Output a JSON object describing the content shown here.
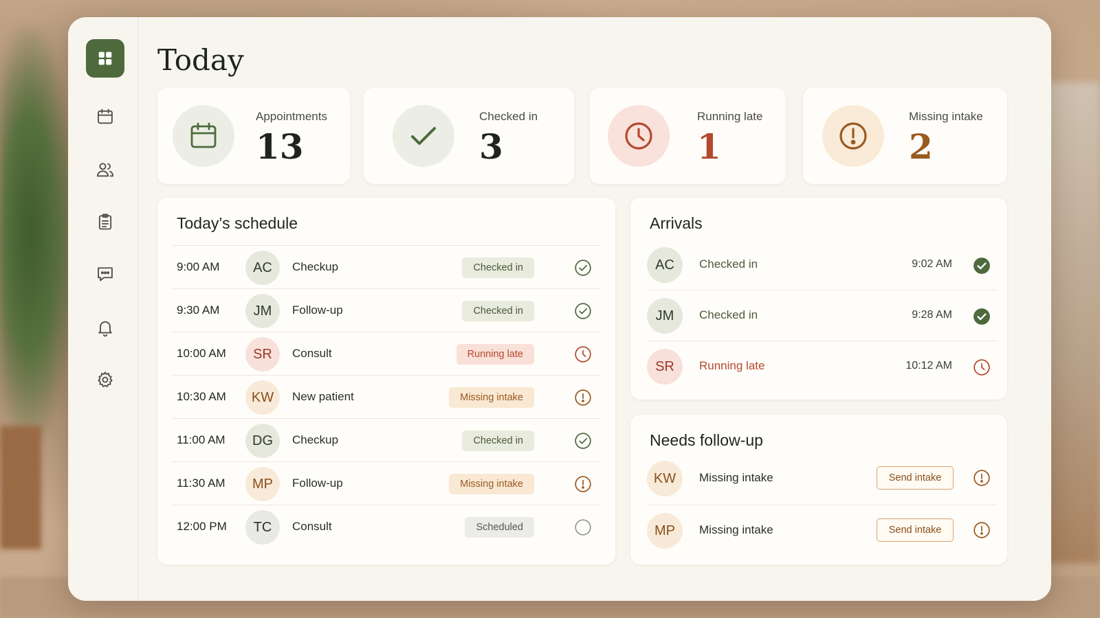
{
  "page": {
    "title": "Today"
  },
  "sidebar": {
    "items": [
      {
        "name": "dashboard",
        "icon": "grid-icon",
        "active": true
      },
      {
        "name": "calendar",
        "icon": "calendar-icon",
        "active": false
      },
      {
        "name": "patients",
        "icon": "users-icon",
        "active": false
      },
      {
        "name": "forms",
        "icon": "clipboard-icon",
        "active": false
      },
      {
        "name": "messages",
        "icon": "chat-icon",
        "active": false
      },
      {
        "name": "notifications",
        "icon": "bell-icon",
        "active": false
      },
      {
        "name": "settings",
        "icon": "gear-icon",
        "active": false
      }
    ]
  },
  "stats": [
    {
      "label": "Appointments",
      "value": "13",
      "icon": "calendar-icon",
      "color": "#1f2420"
    },
    {
      "label": "Checked in",
      "value": "3",
      "icon": "check-icon",
      "color": "#1f2420"
    },
    {
      "label": "Running late",
      "value": "1",
      "icon": "clock-icon",
      "color": "#b3492e"
    },
    {
      "label": "Missing intake",
      "value": "2",
      "icon": "alert-icon",
      "color": "#9a5a21"
    }
  ],
  "schedule": {
    "title": "Today’s schedule",
    "rows": [
      {
        "time": "9:00 AM",
        "initials": "AC",
        "type": "Checkup",
        "status": "Checked in",
        "kind": "checked"
      },
      {
        "time": "9:30 AM",
        "initials": "JM",
        "type": "Follow-up",
        "status": "Checked in",
        "kind": "checked"
      },
      {
        "time": "10:00 AM",
        "initials": "SR",
        "type": "Consult",
        "status": "Running late",
        "kind": "late"
      },
      {
        "time": "10:30 AM",
        "initials": "KW",
        "type": "New patient",
        "status": "Missing intake",
        "kind": "missing"
      },
      {
        "time": "11:00 AM",
        "initials": "DG",
        "type": "Checkup",
        "status": "Checked in",
        "kind": "checked"
      },
      {
        "time": "11:30 AM",
        "initials": "MP",
        "type": "Follow-up",
        "status": "Missing intake",
        "kind": "missing"
      },
      {
        "time": "12:00 PM",
        "initials": "TC",
        "type": "Consult",
        "status": "Scheduled",
        "kind": "scheduled"
      }
    ]
  },
  "arrivals": {
    "title": "Arrivals",
    "rows": [
      {
        "initials": "AC",
        "status": "Checked in",
        "time": "9:02 AM",
        "kind": "checked"
      },
      {
        "initials": "JM",
        "status": "Checked in",
        "time": "9:28 AM",
        "kind": "checked"
      },
      {
        "initials": "SR",
        "status": "Running late",
        "time": "10:12 AM",
        "kind": "late"
      }
    ]
  },
  "followup": {
    "title": "Needs follow-up",
    "rows": [
      {
        "initials": "KW",
        "desc": "Missing intake",
        "action": "Send intake"
      },
      {
        "initials": "MP",
        "desc": "Missing intake",
        "action": "Send intake"
      }
    ]
  },
  "colors": {
    "accent": "#4e6a3d",
    "checked": "#4c5a3a",
    "late": "#b3492e",
    "missing": "#9a5a21"
  }
}
